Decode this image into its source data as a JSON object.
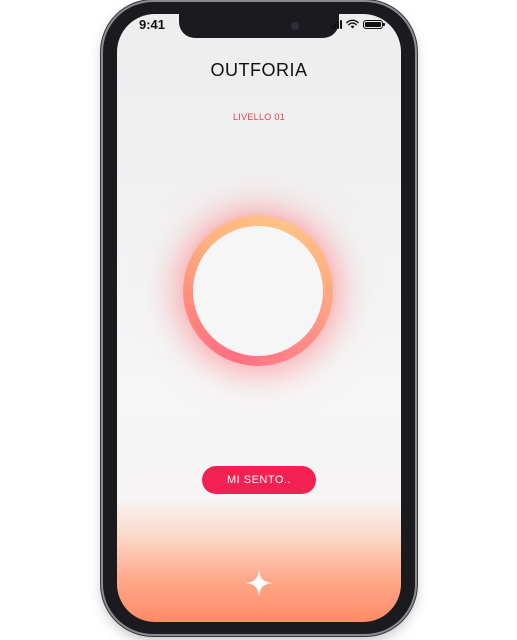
{
  "status_bar": {
    "time": "9:41",
    "icons": [
      "signal-icon",
      "wifi-icon",
      "battery-icon"
    ]
  },
  "header": {
    "title": "OUTFORIA"
  },
  "level": {
    "label": "LIVELLO 01"
  },
  "orb": {
    "gradient_colors": [
      "#ff6f83",
      "#ffb57f",
      "#ffc386"
    ]
  },
  "cta": {
    "label": "MI SENTO.."
  },
  "bottom": {
    "icon": "sparkle-icon"
  },
  "colors": {
    "accent": "#f32152",
    "level_text": "#ef3b47",
    "bottom_gradient": "#ff8a66"
  }
}
